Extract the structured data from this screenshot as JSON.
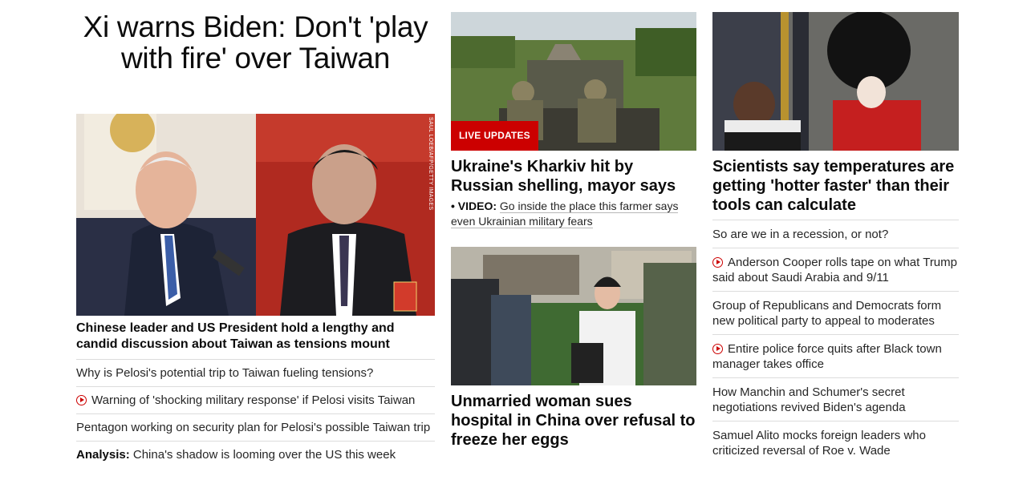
{
  "left": {
    "headline": "Xi warns Biden: Don't 'play with fire' over Taiwan",
    "image_credit": "SAUL LOEB/AFP/GETTY IMAGES",
    "lede": "Chinese leader and US President hold a lengthy and candid discussion about Taiwan as tensions mount",
    "links": [
      {
        "label": "",
        "text": "Why is Pelosi's potential trip to Taiwan fueling tensions?",
        "icon": ""
      },
      {
        "label": "",
        "text": "Warning of 'shocking military response' if Pelosi visits Taiwan",
        "icon": "play-icon"
      },
      {
        "label": "",
        "text": "Pentagon working on security plan for Pelosi's possible Taiwan trip",
        "icon": ""
      },
      {
        "label": "Analysis:",
        "text": "China's shadow is looming over the US this week",
        "icon": ""
      }
    ]
  },
  "middle": {
    "story1": {
      "badge": "LIVE UPDATES",
      "headline": "Ukraine's Kharkiv hit by Russian shelling, mayor says",
      "sub_prefix": "• ",
      "sub_label": "VIDEO:",
      "sub_text": "Go inside the place this farmer says even Ukrainian military fears"
    },
    "story2": {
      "headline": "Unmarried woman sues hospital in China over refusal to freeze her eggs"
    }
  },
  "right": {
    "headline": "Scientists say temperatures are getting 'hotter faster' than their tools can calculate",
    "links": [
      {
        "text": "So are we in a recession, or not?",
        "icon": ""
      },
      {
        "text": "Anderson Cooper rolls tape on what Trump said about Saudi Arabia and 9/11",
        "icon": "play-icon"
      },
      {
        "text": "Group of Republicans and Democrats form new political party to appeal to moderates",
        "icon": ""
      },
      {
        "text": "Entire police force quits after Black town manager takes office",
        "icon": "play-icon"
      },
      {
        "text": "How Manchin and Schumer's secret negotiations revived Biden's agenda",
        "icon": ""
      },
      {
        "text": "Samuel Alito mocks foreign leaders who criticized reversal of Roe v. Wade",
        "icon": ""
      }
    ]
  },
  "colors": {
    "accent_red": "#cc0000",
    "text": "#0c0c0c",
    "divider": "#dcdcdc"
  }
}
